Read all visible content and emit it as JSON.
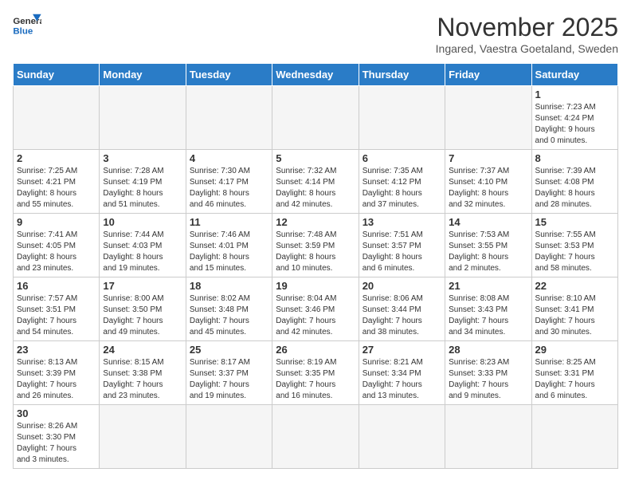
{
  "header": {
    "logo_general": "General",
    "logo_blue": "Blue",
    "title": "November 2025",
    "subtitle": "Ingared, Vaestra Goetaland, Sweden"
  },
  "weekdays": [
    "Sunday",
    "Monday",
    "Tuesday",
    "Wednesday",
    "Thursday",
    "Friday",
    "Saturday"
  ],
  "weeks": [
    [
      {
        "day": "",
        "info": ""
      },
      {
        "day": "",
        "info": ""
      },
      {
        "day": "",
        "info": ""
      },
      {
        "day": "",
        "info": ""
      },
      {
        "day": "",
        "info": ""
      },
      {
        "day": "",
        "info": ""
      },
      {
        "day": "1",
        "info": "Sunrise: 7:23 AM\nSunset: 4:24 PM\nDaylight: 9 hours\nand 0 minutes."
      }
    ],
    [
      {
        "day": "2",
        "info": "Sunrise: 7:25 AM\nSunset: 4:21 PM\nDaylight: 8 hours\nand 55 minutes."
      },
      {
        "day": "3",
        "info": "Sunrise: 7:28 AM\nSunset: 4:19 PM\nDaylight: 8 hours\nand 51 minutes."
      },
      {
        "day": "4",
        "info": "Sunrise: 7:30 AM\nSunset: 4:17 PM\nDaylight: 8 hours\nand 46 minutes."
      },
      {
        "day": "5",
        "info": "Sunrise: 7:32 AM\nSunset: 4:14 PM\nDaylight: 8 hours\nand 42 minutes."
      },
      {
        "day": "6",
        "info": "Sunrise: 7:35 AM\nSunset: 4:12 PM\nDaylight: 8 hours\nand 37 minutes."
      },
      {
        "day": "7",
        "info": "Sunrise: 7:37 AM\nSunset: 4:10 PM\nDaylight: 8 hours\nand 32 minutes."
      },
      {
        "day": "8",
        "info": "Sunrise: 7:39 AM\nSunset: 4:08 PM\nDaylight: 8 hours\nand 28 minutes."
      }
    ],
    [
      {
        "day": "9",
        "info": "Sunrise: 7:41 AM\nSunset: 4:05 PM\nDaylight: 8 hours\nand 23 minutes."
      },
      {
        "day": "10",
        "info": "Sunrise: 7:44 AM\nSunset: 4:03 PM\nDaylight: 8 hours\nand 19 minutes."
      },
      {
        "day": "11",
        "info": "Sunrise: 7:46 AM\nSunset: 4:01 PM\nDaylight: 8 hours\nand 15 minutes."
      },
      {
        "day": "12",
        "info": "Sunrise: 7:48 AM\nSunset: 3:59 PM\nDaylight: 8 hours\nand 10 minutes."
      },
      {
        "day": "13",
        "info": "Sunrise: 7:51 AM\nSunset: 3:57 PM\nDaylight: 8 hours\nand 6 minutes."
      },
      {
        "day": "14",
        "info": "Sunrise: 7:53 AM\nSunset: 3:55 PM\nDaylight: 8 hours\nand 2 minutes."
      },
      {
        "day": "15",
        "info": "Sunrise: 7:55 AM\nSunset: 3:53 PM\nDaylight: 7 hours\nand 58 minutes."
      }
    ],
    [
      {
        "day": "16",
        "info": "Sunrise: 7:57 AM\nSunset: 3:51 PM\nDaylight: 7 hours\nand 54 minutes."
      },
      {
        "day": "17",
        "info": "Sunrise: 8:00 AM\nSunset: 3:50 PM\nDaylight: 7 hours\nand 49 minutes."
      },
      {
        "day": "18",
        "info": "Sunrise: 8:02 AM\nSunset: 3:48 PM\nDaylight: 7 hours\nand 45 minutes."
      },
      {
        "day": "19",
        "info": "Sunrise: 8:04 AM\nSunset: 3:46 PM\nDaylight: 7 hours\nand 42 minutes."
      },
      {
        "day": "20",
        "info": "Sunrise: 8:06 AM\nSunset: 3:44 PM\nDaylight: 7 hours\nand 38 minutes."
      },
      {
        "day": "21",
        "info": "Sunrise: 8:08 AM\nSunset: 3:43 PM\nDaylight: 7 hours\nand 34 minutes."
      },
      {
        "day": "22",
        "info": "Sunrise: 8:10 AM\nSunset: 3:41 PM\nDaylight: 7 hours\nand 30 minutes."
      }
    ],
    [
      {
        "day": "23",
        "info": "Sunrise: 8:13 AM\nSunset: 3:39 PM\nDaylight: 7 hours\nand 26 minutes."
      },
      {
        "day": "24",
        "info": "Sunrise: 8:15 AM\nSunset: 3:38 PM\nDaylight: 7 hours\nand 23 minutes."
      },
      {
        "day": "25",
        "info": "Sunrise: 8:17 AM\nSunset: 3:37 PM\nDaylight: 7 hours\nand 19 minutes."
      },
      {
        "day": "26",
        "info": "Sunrise: 8:19 AM\nSunset: 3:35 PM\nDaylight: 7 hours\nand 16 minutes."
      },
      {
        "day": "27",
        "info": "Sunrise: 8:21 AM\nSunset: 3:34 PM\nDaylight: 7 hours\nand 13 minutes."
      },
      {
        "day": "28",
        "info": "Sunrise: 8:23 AM\nSunset: 3:33 PM\nDaylight: 7 hours\nand 9 minutes."
      },
      {
        "day": "29",
        "info": "Sunrise: 8:25 AM\nSunset: 3:31 PM\nDaylight: 7 hours\nand 6 minutes."
      }
    ],
    [
      {
        "day": "30",
        "info": "Sunrise: 8:26 AM\nSunset: 3:30 PM\nDaylight: 7 hours\nand 3 minutes."
      },
      {
        "day": "",
        "info": ""
      },
      {
        "day": "",
        "info": ""
      },
      {
        "day": "",
        "info": ""
      },
      {
        "day": "",
        "info": ""
      },
      {
        "day": "",
        "info": ""
      },
      {
        "day": "",
        "info": ""
      }
    ]
  ]
}
